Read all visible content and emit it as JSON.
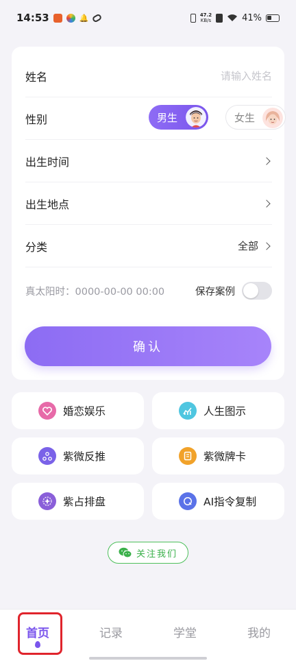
{
  "status_bar": {
    "time": "14:53",
    "net_speed_value": "47.2",
    "net_speed_unit": "KB/s",
    "battery": "41%"
  },
  "form": {
    "name_label": "姓名",
    "name_placeholder": "请输入姓名",
    "gender_label": "性别",
    "male": "男生",
    "female": "女生",
    "birth_time_label": "出生时间",
    "birth_place_label": "出生地点",
    "category_label": "分类",
    "category_value": "全部",
    "solar_time": "真太阳时：0000-00-00 00:00",
    "save_case_label": "保存案例",
    "confirm": "确认"
  },
  "tools": [
    {
      "label": "婚恋娱乐",
      "icon": "heart-icon",
      "color": "#e76aa8"
    },
    {
      "label": "人生图示",
      "icon": "chart-icon",
      "color": "#4fc6e0"
    },
    {
      "label": "紫微反推",
      "icon": "triangle-dots-icon",
      "color": "#7a62e8"
    },
    {
      "label": "紫微牌卡",
      "icon": "card-icon",
      "color": "#f1a22a"
    },
    {
      "label": "紫占排盘",
      "icon": "star-wheel-icon",
      "color": "#8a5fd9"
    },
    {
      "label": "AI指令复制",
      "icon": "ai-icon",
      "color": "#5a72e8"
    }
  ],
  "follow": "关注我们",
  "nav": {
    "home": "首页",
    "records": "记录",
    "study": "学堂",
    "mine": "我的"
  },
  "colors": {
    "accent": "#7a55ec",
    "follow_green": "#3ab04a",
    "highlight_red": "#e0242c"
  }
}
